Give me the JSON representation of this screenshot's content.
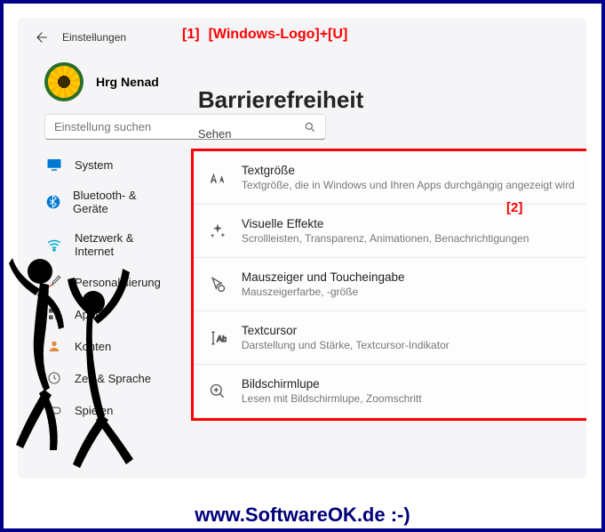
{
  "annotation": {
    "marker1_index": "[1]",
    "marker1_text": "[Windows-Logo]+[U]",
    "marker2": "[2]"
  },
  "header": {
    "title": "Einstellungen"
  },
  "user": {
    "name": "Hrg Nenad"
  },
  "search": {
    "placeholder": "Einstellung suchen"
  },
  "sidebar": {
    "items": [
      {
        "label": "System"
      },
      {
        "label": "Bluetooth- & Geräte"
      },
      {
        "label": "Netzwerk & Internet"
      },
      {
        "label": "Personalisierung"
      },
      {
        "label": "Apps"
      },
      {
        "label": "Konten"
      },
      {
        "label": "Zeit & Sprache"
      },
      {
        "label": "Spielen"
      }
    ]
  },
  "main": {
    "title": "Barrierefreiheit",
    "section": "Sehen",
    "cards": [
      {
        "title": "Textgröße",
        "sub": "Textgröße, die in Windows und Ihren Apps durchgängig angezeigt wird"
      },
      {
        "title": "Visuelle Effekte",
        "sub": "Scrollleisten, Transparenz, Animationen, Benachrichtigungen"
      },
      {
        "title": "Mauszeiger und Toucheingabe",
        "sub": "Mauszeigerfarbe, -größe"
      },
      {
        "title": "Textcursor",
        "sub": "Darstellung und Stärke, Textcursor-Indikator"
      },
      {
        "title": "Bildschirmlupe",
        "sub": "Lesen mit Bildschirmlupe, Zoomschritt"
      }
    ]
  },
  "footer": {
    "text": "www.SoftwareOK.de :-)"
  }
}
